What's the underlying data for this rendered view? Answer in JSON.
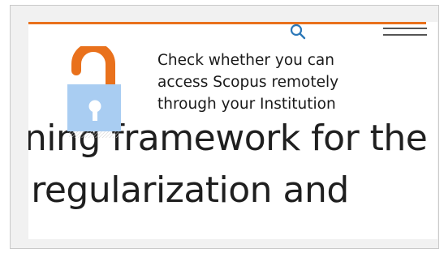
{
  "promo": {
    "line1": "Check whether you can",
    "line2": "access Scopus remotely",
    "line3": "through your Institution"
  },
  "background_title": {
    "line1": "rning framework for the",
    "line2": "l regularization and"
  },
  "icons": {
    "search": "search-icon",
    "menu": "hamburger-menu-icon",
    "lock": "open-padlock-icon"
  },
  "colors": {
    "accent_orange": "#e9711c",
    "lock_body_blue": "#a9cdf2",
    "search_blue": "#2c78b8"
  }
}
